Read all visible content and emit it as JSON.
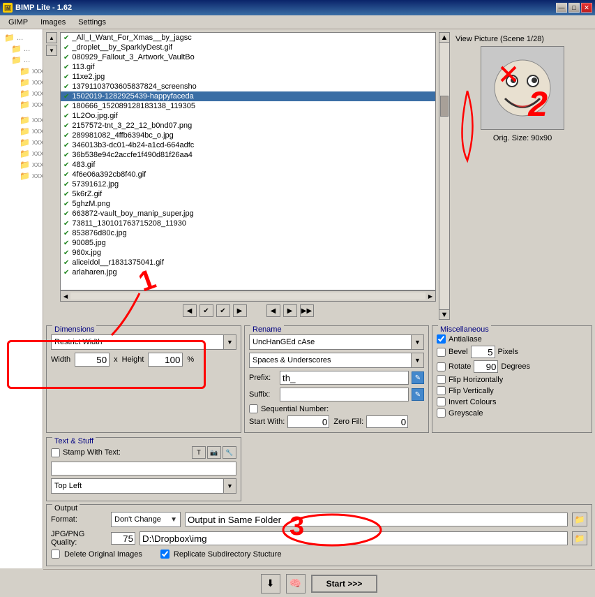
{
  "window": {
    "title": "BIMP Lite - 1.62",
    "icon": "🖼"
  },
  "titleButtons": {
    "minimize": "—",
    "maximize": "□",
    "close": "✕"
  },
  "menu": {
    "items": [
      "GIMP",
      "Images",
      "Settings"
    ]
  },
  "fileList": {
    "items": [
      {
        "name": "_All_I_Want_For_Xmas__by_jagsc",
        "checked": true
      },
      {
        "name": "_droplet__by_SparklyDest.gif",
        "checked": true
      },
      {
        "name": "080929_Fallout_3_Artwork_VaultBo",
        "checked": true
      },
      {
        "name": "113.gif",
        "checked": true
      },
      {
        "name": "11xe2.jpg",
        "checked": true
      },
      {
        "name": "13791103703605837824_screensho",
        "checked": true
      },
      {
        "name": "1502019-1282925439-happyfaceda",
        "checked": true,
        "selected": true
      },
      {
        "name": "180666_152089128183138_119305",
        "checked": true
      },
      {
        "name": "1L2Oo.jpg.gif",
        "checked": true
      },
      {
        "name": "2157572-tnt_3_22_12_b0nd07.png",
        "checked": true
      },
      {
        "name": "289981082_4ffb6394bc_o.jpg",
        "checked": true
      },
      {
        "name": "346013b3-dc01-4b24-a1cd-664adfc",
        "checked": true
      },
      {
        "name": "36b538e94c2accfe1f490d81f26aa4",
        "checked": true
      },
      {
        "name": "483.gif",
        "checked": true
      },
      {
        "name": "4f6e06a392cb8f40.gif",
        "checked": true
      },
      {
        "name": "57391612.jpg",
        "checked": true
      },
      {
        "name": "5k6rZ.gif",
        "checked": true
      },
      {
        "name": "5ghzM.png",
        "checked": true
      },
      {
        "name": "663872-vault_boy_manip_super.jpg",
        "checked": true
      },
      {
        "name": "73811_130101763715208_11930",
        "checked": true
      },
      {
        "name": "853876d80c.jpg",
        "checked": true
      },
      {
        "name": "90085.jpg",
        "checked": true
      },
      {
        "name": "960x.jpg",
        "checked": true
      },
      {
        "name": "aliceidol__r1831375041.gif",
        "checked": true
      },
      {
        "name": "arlaharen.jpg",
        "checked": true
      }
    ]
  },
  "preview": {
    "title": "View Picture (Scene 1/28)",
    "origSize": "Orig. Size: 90x90"
  },
  "dimensions": {
    "label": "Dimensions",
    "selectValue": "Restrict Width",
    "widthLabel": "Width",
    "heightLabel": "Height",
    "percentLabel": "%",
    "widthValue": "50",
    "heightValue": "100",
    "crossLabel": "x"
  },
  "rename": {
    "label": "Rename",
    "caseSelect": "UncHanGEd cAse",
    "underscoreSelect": "Spaces & Underscores",
    "prefixLabel": "Prefix:",
    "prefixValue": "th_",
    "suffixLabel": "Suffix:",
    "suffixValue": "",
    "sequentialLabel": "Sequential Number:",
    "startWithLabel": "Start With:",
    "startWithValue": "0",
    "zeroFillLabel": "Zero Fill:",
    "zeroFillValue": "0"
  },
  "misc": {
    "label": "Miscellaneous",
    "antialiasLabel": "Antialiase",
    "antialiasChecked": true,
    "bevelLabel": "Bevel",
    "bevelChecked": false,
    "bevelValue": "5",
    "bevelUnit": "Pixels",
    "rotateLabel": "Rotate",
    "rotateChecked": false,
    "rotateValue": "90",
    "rotateUnit": "Degrees",
    "flipHLabel": "Flip Horizontally",
    "flipHChecked": false,
    "flipVLabel": "Flip Vertically",
    "flipVChecked": false,
    "invertLabel": "Invert Colours",
    "invertChecked": false,
    "greyscaleLabel": "Greyscale",
    "greyscaleChecked": false
  },
  "textStuff": {
    "label": "Text & Stuff",
    "stampLabel": "Stamp With Text:",
    "stampChecked": false,
    "stampValue": "",
    "positionSelect": "Top Left"
  },
  "output": {
    "label": "Output",
    "formatLabel": "Format:",
    "formatValue": "Don't Change",
    "outputLabel": "Output in Same Folder",
    "qualityLabel": "JPG/PNG Quality:",
    "qualityValue": "75",
    "pathValue": "D:\\Dropbox\\img",
    "deleteLabel": "Delete Original Images",
    "deleteChecked": false,
    "replicateLabel": "Replicate Subdirectory Stucture",
    "replicateChecked": true
  },
  "startButton": {
    "label": "Start >>>"
  },
  "navButtons": {
    "back": "◀◀◀",
    "play": "▶▶▶",
    "pause": "⏸"
  },
  "annotations": {
    "one": "1",
    "two": "2",
    "three": "3"
  }
}
